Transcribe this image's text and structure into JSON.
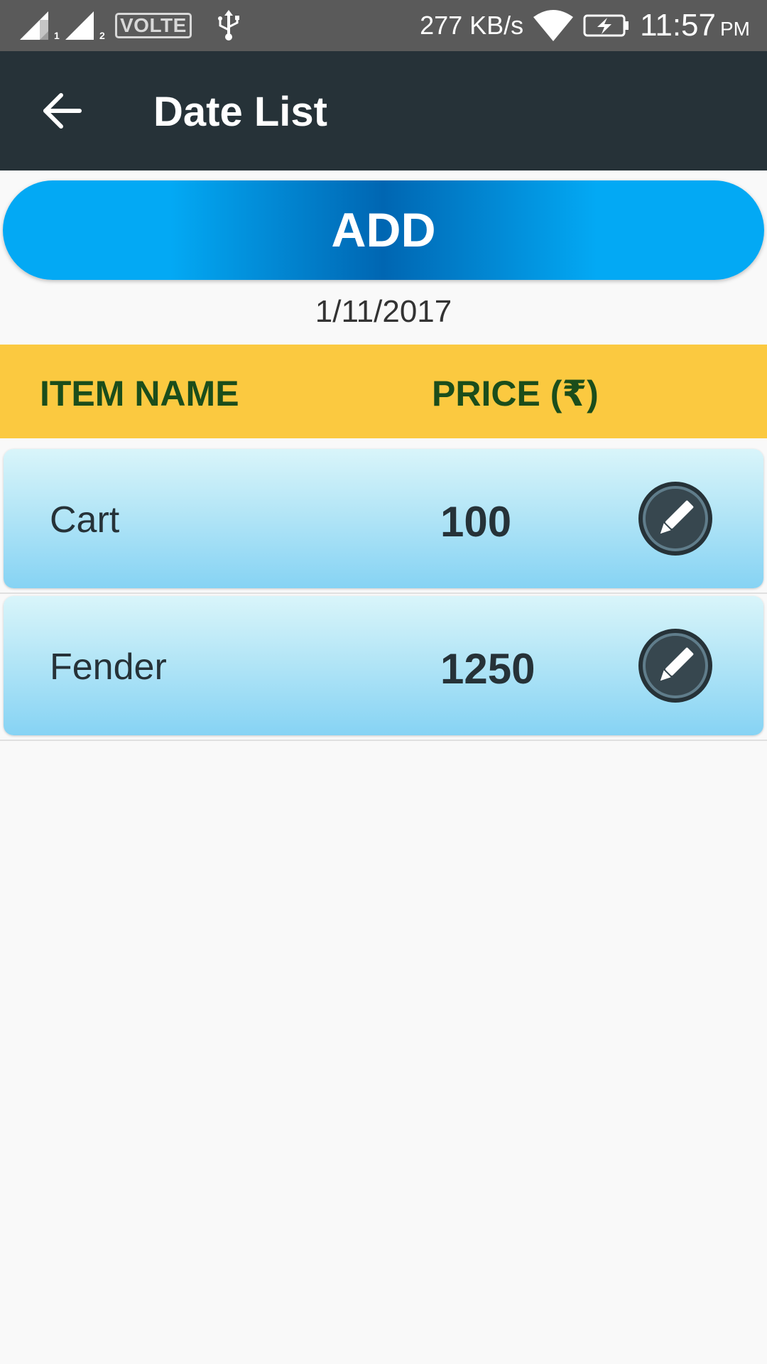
{
  "status_bar": {
    "sim1_label": "1",
    "sim2_label": "2",
    "volte_label": "VOLTE",
    "net_speed": "277 KB/s",
    "time": "11:57",
    "ampm": "PM",
    "icons": [
      "signal-sim1-icon",
      "signal-sim2-icon",
      "volte-icon",
      "usb-icon",
      "wifi-icon",
      "battery-charging-icon"
    ]
  },
  "app_bar": {
    "title": "Date List",
    "back_icon": "arrow-back-icon"
  },
  "add_button": {
    "label": "ADD"
  },
  "date": "1/11/2017",
  "table": {
    "headers": {
      "item_name": "ITEM NAME",
      "price": "PRICE (₹)"
    },
    "rows": [
      {
        "name": "Cart",
        "price": "100",
        "action_icon": "edit-pencil-icon"
      },
      {
        "name": "Fender",
        "price": "1250",
        "action_icon": "edit-pencil-icon"
      }
    ]
  },
  "colors": {
    "status_bar": "#5a5a5a",
    "app_bar": "#263238",
    "add_button_light": "#03a9f4",
    "add_button_dark": "#0066b2",
    "header_bar": "#fbc940",
    "header_text": "#1b4d1b",
    "row_top": "#d9f5fa",
    "row_bottom": "#86d3f4",
    "edit_button": "#37474f"
  }
}
